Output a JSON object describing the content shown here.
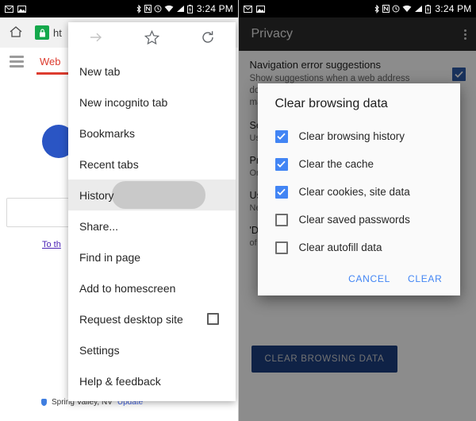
{
  "status_bar": {
    "time": "3:24 PM",
    "left_icons": [
      "gmail-icon",
      "screenshot-icon"
    ],
    "right_icons": [
      "bluetooth-icon",
      "nfc-icon",
      "alarm-icon",
      "wifi-icon",
      "signal-icon",
      "battery-icon"
    ]
  },
  "left_panel": {
    "toolbar": {
      "home_icon": "home-icon",
      "lock_icon": "lock-icon",
      "url_fragment": "ht"
    },
    "tabs": {
      "menu_icon": "hamburger-icon",
      "active_tab": "Web"
    },
    "page": {
      "link_text": "To th",
      "location": "Spring Valley, NV",
      "update_label": "Update"
    },
    "menu": {
      "top_actions": [
        {
          "name": "forward-icon",
          "glyph": "forward"
        },
        {
          "name": "bookmark-star-icon",
          "glyph": "star"
        },
        {
          "name": "reload-icon",
          "glyph": "reload"
        }
      ],
      "items": [
        {
          "label": "New tab",
          "selected": false,
          "checkbox": false
        },
        {
          "label": "New incognito tab",
          "selected": false,
          "checkbox": false
        },
        {
          "label": "Bookmarks",
          "selected": false,
          "checkbox": false
        },
        {
          "label": "Recent tabs",
          "selected": false,
          "checkbox": false
        },
        {
          "label": "History",
          "selected": true,
          "checkbox": false
        },
        {
          "label": "Share...",
          "selected": false,
          "checkbox": false
        },
        {
          "label": "Find in page",
          "selected": false,
          "checkbox": false
        },
        {
          "label": "Add to homescreen",
          "selected": false,
          "checkbox": false
        },
        {
          "label": "Request desktop site",
          "selected": false,
          "checkbox": true
        },
        {
          "label": "Settings",
          "selected": false,
          "checkbox": false
        },
        {
          "label": "Help & feedback",
          "selected": false,
          "checkbox": false
        }
      ]
    }
  },
  "right_panel": {
    "appbar": {
      "title": "Privacy",
      "overflow_icon": "kebab-menu-icon"
    },
    "navigation_error": {
      "title": "Navigation error suggestions",
      "summary": "Show suggestions when a web address does not resolve or a connection cannot be made",
      "checked": true
    },
    "hidden_sections": [
      {
        "title": "Se",
        "summary": "Us"
      },
      {
        "title": "Pr",
        "summary": "Or"
      },
      {
        "title": "Us",
        "summary": "Ne"
      },
      {
        "title": "'D",
        "summary": "of"
      }
    ],
    "clear_browsing_data_button": "CLEAR BROWSING DATA",
    "dialog": {
      "title": "Clear browsing data",
      "options": [
        {
          "label": "Clear browsing history",
          "checked": true
        },
        {
          "label": "Clear the cache",
          "checked": true
        },
        {
          "label": "Clear cookies, site data",
          "checked": true
        },
        {
          "label": "Clear saved passwords",
          "checked": false
        },
        {
          "label": "Clear autofill data",
          "checked": false
        }
      ],
      "cancel_label": "CANCEL",
      "confirm_label": "CLEAR"
    }
  },
  "colors": {
    "accent_blue": "#4285f4",
    "statusbar_black": "#000000",
    "appbar_dark": "#2c2c2c",
    "tab_red": "#dd3c2f",
    "lock_green": "#14a84b",
    "button_blue": "#1d3f80"
  }
}
